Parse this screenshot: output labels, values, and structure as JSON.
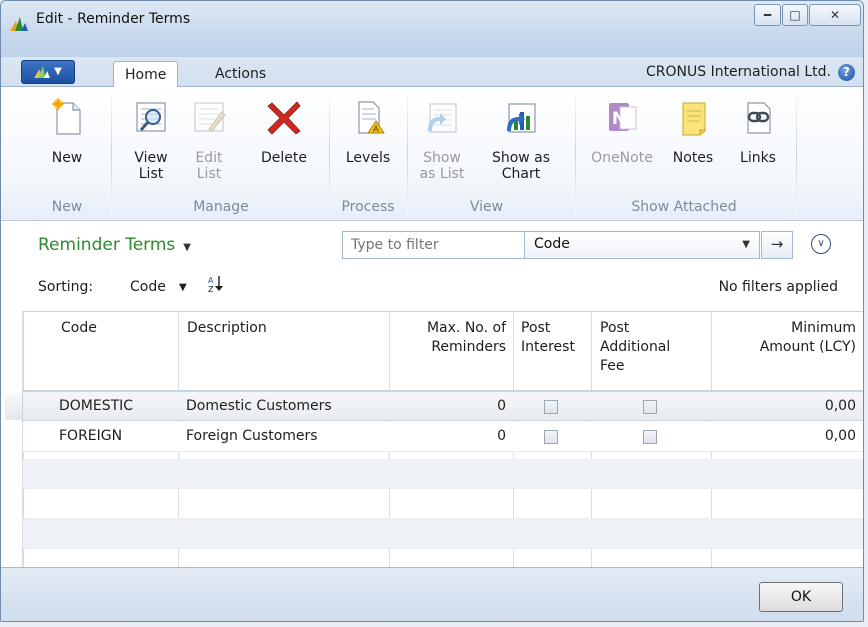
{
  "window": {
    "title": "Edit - Reminder Terms"
  },
  "tabs": {
    "home": "Home",
    "actions": "Actions"
  },
  "company": "CRONUS International Ltd.",
  "help_icon": "help-icon",
  "ribbon": {
    "new_group": {
      "label": "New",
      "buttons": {
        "new": "New"
      }
    },
    "manage_group": {
      "label": "Manage",
      "buttons": {
        "view_list_1": "View",
        "view_list_2": "List",
        "edit_list_1": "Edit",
        "edit_list_2": "List",
        "delete": "Delete"
      }
    },
    "process_group": {
      "label": "Process",
      "buttons": {
        "levels": "Levels"
      }
    },
    "view_group": {
      "label": "View",
      "buttons": {
        "show_as_list_1": "Show",
        "show_as_list_2": "as List",
        "show_as_chart_1": "Show as",
        "show_as_chart_2": "Chart"
      }
    },
    "show_attached_group": {
      "label": "Show Attached",
      "buttons": {
        "onenote": "OneNote",
        "notes": "Notes",
        "links": "Links"
      }
    }
  },
  "page": {
    "title": "Reminder Terms",
    "filter_placeholder": "Type to filter",
    "filter_field": "Code",
    "sorting_label": "Sorting:",
    "sorting_value": "Code",
    "filters_status": "No filters applied"
  },
  "grid": {
    "headers": {
      "code": "Code",
      "description": "Description",
      "max_reminders_1": "Max. No. of",
      "max_reminders_2": "Reminders",
      "post_interest_1": "Post",
      "post_interest_2": "Interest",
      "post_fee_1": "Post",
      "post_fee_2": "Additional",
      "post_fee_3": "Fee",
      "min_amount_1": "Minimum",
      "min_amount_2": "Amount (LCY)"
    },
    "rows": [
      {
        "code": "DOMESTIC",
        "description": "Domestic Customers",
        "max_reminders": "0",
        "post_interest": false,
        "post_fee": false,
        "min_amount": "0,00"
      },
      {
        "code": "FOREIGN",
        "description": "Foreign Customers",
        "max_reminders": "0",
        "post_interest": false,
        "post_fee": false,
        "min_amount": "0,00"
      }
    ]
  },
  "footer": {
    "ok": "OK"
  },
  "colors": {
    "title_green": "#2d8a2d",
    "app_blue": "#1d4f9e",
    "delete_red": "#d0281e"
  }
}
